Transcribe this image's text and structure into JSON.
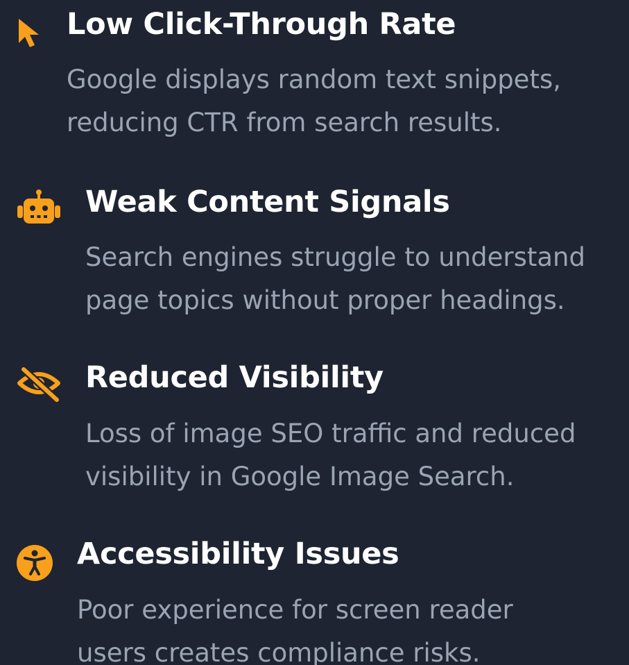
{
  "theme": {
    "background": "#1e2431",
    "accent": "#f8a01c",
    "title_color": "#ffffff",
    "text_color": "#9aa4b4"
  },
  "issues": [
    {
      "icon": "cursor-arrow-icon",
      "title": "Low Click-Through Rate",
      "description_lines": [
        "Google displays random text snippets,",
        "reducing CTR from search results."
      ]
    },
    {
      "icon": "robot-icon",
      "title": "Weak Content Signals",
      "description_lines": [
        "Search engines struggle to understand",
        "page topics without proper headings."
      ]
    },
    {
      "icon": "eye-slash-icon",
      "title": "Reduced Visibility",
      "description_lines": [
        "Loss of image SEO traffic and reduced",
        "visibility in Google Image Search."
      ]
    },
    {
      "icon": "accessibility-icon",
      "title": "Accessibility Issues",
      "description_lines": [
        "Poor experience for screen reader",
        "users creates compliance risks."
      ]
    }
  ]
}
